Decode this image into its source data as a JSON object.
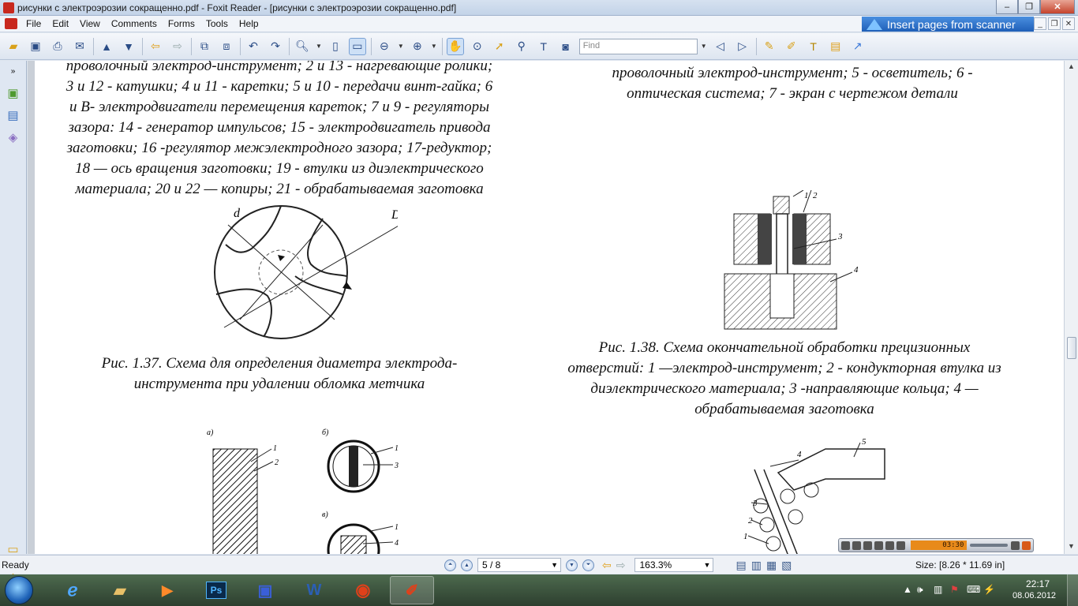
{
  "window": {
    "title": "рисунки с электроэрозии сокращенно.pdf - Foxit Reader - [рисунки с электроэрозии сокращенно.pdf]",
    "minimize": "‒",
    "maximize": "❐",
    "close": "✕"
  },
  "menu": {
    "items": [
      "File",
      "Edit",
      "View",
      "Comments",
      "Forms",
      "Tools",
      "Help"
    ],
    "banner": "Insert pages from scanner",
    "mdi_minimize": "_",
    "mdi_restore": "❐",
    "mdi_close": "✕"
  },
  "toolbar": {
    "find_placeholder": "Find"
  },
  "document": {
    "text_left": "проволочный электрод-инструмент; 2 и 13 - нагревающие ролики; 3 и 12 - катушки; 4 и 11 - каретки; 5 и 10 - передачи винт-гайка; 6 и В- электродвигатели перемещения кареток; 7 и 9 - регуляторы зазора: 14 - генератор импульсов; 15 - электродвигатель привода заготовки; 16 -регулятор межэлектродного зазора; 17-редуктор; 18 — ось вращения заготовки; 19 - втулки из диэлектрического материала; 20 и 22 — копиры; 21 - обрабатываемая заготовка",
    "text_left_lines": [
      "проволочный электрод-инструмент; 2 и 13 - нагревающие ролики;",
      "3 и 12 - катушки; 4 и 11 - каретки; 5 и 10 - передачи винт-гайка; 6",
      "и В- электродвигатели перемещения кареток; 7 и 9 - регуляторы",
      "зазора: 14 - генератор импульсов; 15 - электродвигатель привода",
      "заготовки; 16 -регулятор межэлектродного зазора; 17-редуктор;",
      "18 — ось вращения заготовки; 19 - втулки из диэлектрического",
      "материала; 20 и 22 — копиры; 21 - обрабатываемая заготовка"
    ],
    "text_right_lines": [
      "проволочный электрод-инструмент; 5 - осветитель; 6 -",
      "оптическая система; 7 - экран с чертежом детали"
    ],
    "fig137_label_d": "d",
    "fig137_label_D": "D",
    "fig137_caption_lines": [
      "Рис. 1.37. Схема для определения диаметра электрода-",
      "инструмента при удалении обломка метчика"
    ],
    "fig138_numbers": [
      "1",
      "2",
      "3",
      "4"
    ],
    "fig138_caption_lines": [
      "Рис. 1.38. Схема окончательной обработки прецизионных",
      "отверстий: 1 —электрод-инструмент; 2 - кондукторная втулка из",
      "диэлектрического материала; 3 -направляющие кольца; 4 —",
      "обрабатываемая заготовка"
    ],
    "fig139_panel_labels": [
      "а)",
      "б)",
      "в)"
    ],
    "fig139_numbers": [
      "1",
      "2",
      "1",
      "3",
      "1",
      "4"
    ],
    "fig140_numbers": [
      "4",
      "5",
      "3",
      "2",
      "1"
    ]
  },
  "player": {
    "time": "03:30"
  },
  "status": {
    "ready": "Ready",
    "page": "5 / 8",
    "zoom": "163.3%",
    "size": "Size: [8.26 * 11.69 in]"
  },
  "taskbar": {
    "photoshop": "Ps",
    "clock_time": "22:17",
    "clock_date": "08.06.2012"
  }
}
